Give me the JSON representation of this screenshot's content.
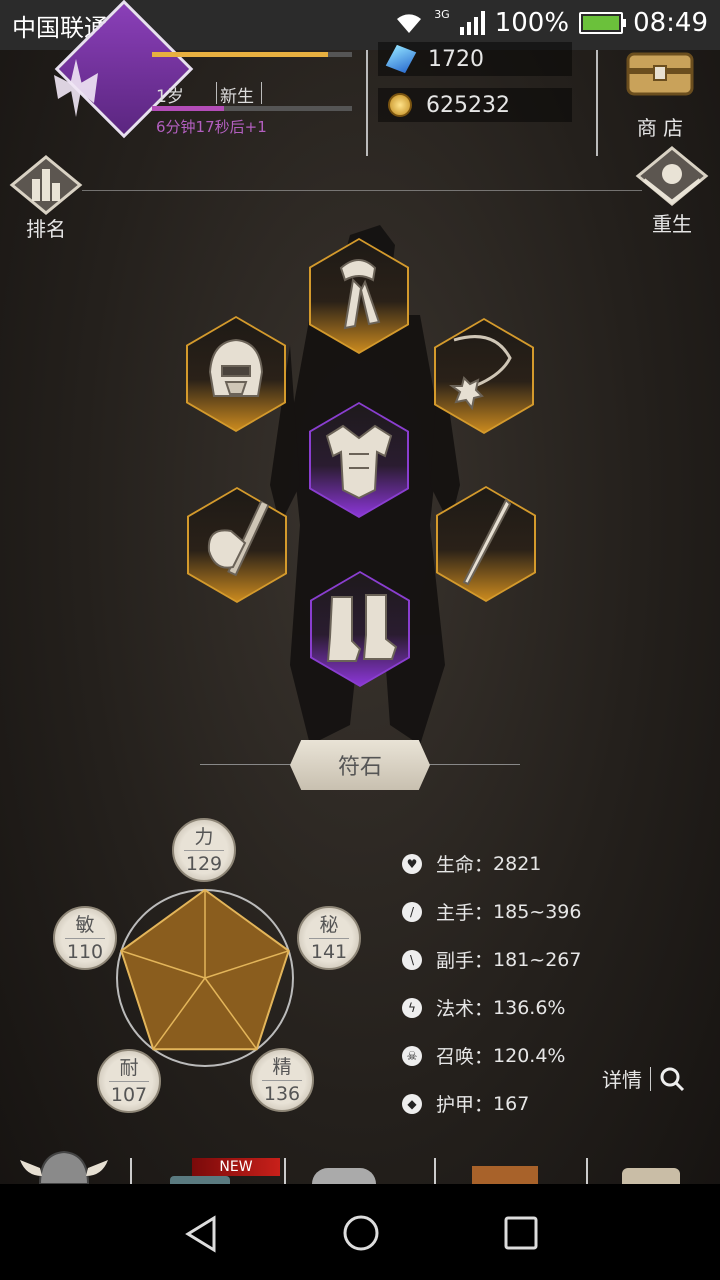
{
  "status_bar": {
    "carrier": "中国联通",
    "network": "3G",
    "battery": "100%",
    "time": "08:49"
  },
  "header": {
    "age": "1岁",
    "stage": "新生",
    "timer": "6分钟17秒后+1",
    "xp_fraction": 0.88,
    "age_fraction": 0.36,
    "gems": "1720",
    "gold": "625232",
    "shop_label": "商 店"
  },
  "side": {
    "rank_label": "排名",
    "rebirth_label": "重生"
  },
  "equipment": [
    {
      "slot": "neck",
      "icon": "scarf-icon",
      "rarity": "gold"
    },
    {
      "slot": "head",
      "icon": "helmet-icon",
      "rarity": "gold"
    },
    {
      "slot": "amulet",
      "icon": "amulet-icon",
      "rarity": "gold"
    },
    {
      "slot": "chest",
      "icon": "armor-icon",
      "rarity": "purple"
    },
    {
      "slot": "main-hand",
      "icon": "axe-icon",
      "rarity": "gold"
    },
    {
      "slot": "off-hand",
      "icon": "wand-icon",
      "rarity": "gold"
    },
    {
      "slot": "feet",
      "icon": "boots-icon",
      "rarity": "purple"
    }
  ],
  "rune_label": "符石",
  "attributes": [
    {
      "name": "力",
      "value": "129"
    },
    {
      "name": "秘",
      "value": "141"
    },
    {
      "name": "精",
      "value": "136"
    },
    {
      "name": "耐",
      "value": "107"
    },
    {
      "name": "敏",
      "value": "110"
    }
  ],
  "stats": [
    {
      "label": "生命：",
      "value": "2821",
      "icon": "heart-icon"
    },
    {
      "label": "主手：",
      "value": "185~396",
      "icon": "sword-icon"
    },
    {
      "label": "副手：",
      "value": "181~267",
      "icon": "dagger-icon"
    },
    {
      "label": "法术：",
      "value": "136.6%",
      "icon": "lightning-icon"
    },
    {
      "label": "召唤：",
      "value": "120.4%",
      "icon": "skull-icon"
    },
    {
      "label": "护甲：",
      "value": "167",
      "icon": "shield-icon"
    }
  ],
  "details_label": "详情",
  "bottom_nav": {
    "new_badge": "NEW"
  },
  "colors": {
    "gold": "#d49a2c",
    "purple": "#8a3ed0",
    "pentagon": "#8a5d1e"
  }
}
